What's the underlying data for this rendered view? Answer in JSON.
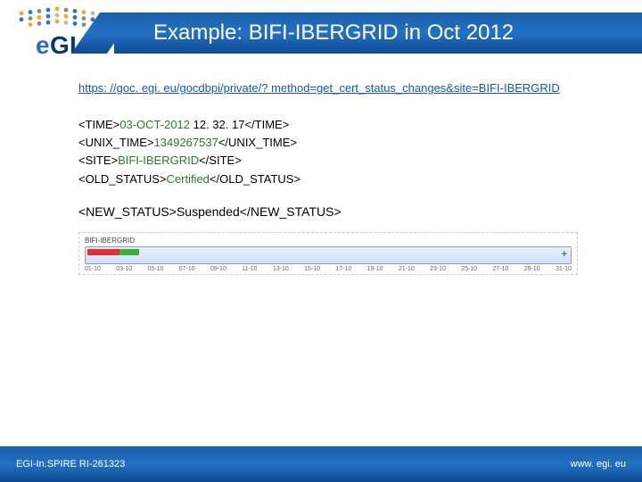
{
  "header": {
    "title": "Example: BIFI-IBERGRID in Oct 2012",
    "logo_text_top": "eGI"
  },
  "url": "https: //goc. egi. eu/gocdbpi/private/? method=get_cert_status_changes&site=BIFI-IBERGRID",
  "xml": {
    "time_open": "<TIME>",
    "time_val": "03-OCT-2012",
    "time_rest": " 12. 32. 17</TIME>",
    "unix_open": "<UNIX_TIME>",
    "unix_val": "1349267537",
    "unix_close": "</UNIX_TIME>",
    "site_open": "<SITE>",
    "site_val": "BIFI-IBERGRID",
    "site_close": "</SITE>",
    "old_open": "<OLD_STATUS>",
    "old_val": "Certified",
    "old_close": "</OLD_STATUS>",
    "new_open": "<NEW_STATUS>",
    "new_val": "Suspended",
    "new_close": "</NEW_STATUS>"
  },
  "chart_data": {
    "type": "bar",
    "title": "BIFI-IBERGRID",
    "categories": [
      "01-10",
      "03-10",
      "05-10",
      "07-10",
      "09-10",
      "11-10",
      "13-10",
      "15-10",
      "17-10",
      "19-10",
      "21-10",
      "23-10",
      "25-10",
      "27-10",
      "29-10",
      "31-10"
    ],
    "series": [
      {
        "name": "red",
        "start": "01-10",
        "end": "03-10",
        "color": "#e03030"
      },
      {
        "name": "green",
        "start": "03-10",
        "end": "04-10",
        "color": "#3fae3f"
      }
    ],
    "plus_icon": "+"
  },
  "footer": {
    "left": "EGI-In.SPIRE RI-261323",
    "right": "www. egi. eu"
  },
  "dot_colors": [
    "#f5a623",
    "#2a78c2",
    "#888",
    "#2a78c2",
    "#f5a623",
    "#888",
    "#2a78c2",
    "#f5a623",
    "#bbb",
    "#2a78c2",
    "#888",
    "#f5a623",
    "#2a78c2",
    "#bbb"
  ]
}
